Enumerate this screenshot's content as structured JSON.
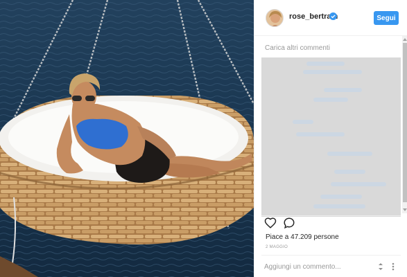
{
  "post": {
    "image_alt": "Donna in bikini blu su un lettino sospeso sul mare",
    "username": "rose_bertram",
    "verified": true,
    "follow_label": "Segui",
    "load_more_comments": "Carica altri commenti",
    "likes_text": "Piace a 47.209 persone",
    "date": "2 MAGGIO",
    "comment_placeholder": "Aggiungi un commento..."
  },
  "icons": {
    "like": "heart-outline-icon",
    "comment": "speech-bubble-icon",
    "verified": "verified-badge-icon",
    "options": "more-options-icon"
  },
  "colors": {
    "follow_button": "#3897f0",
    "verified_badge": "#3897f0",
    "comments_redacted": "#d9d9d9",
    "sea": "#1b3852"
  }
}
